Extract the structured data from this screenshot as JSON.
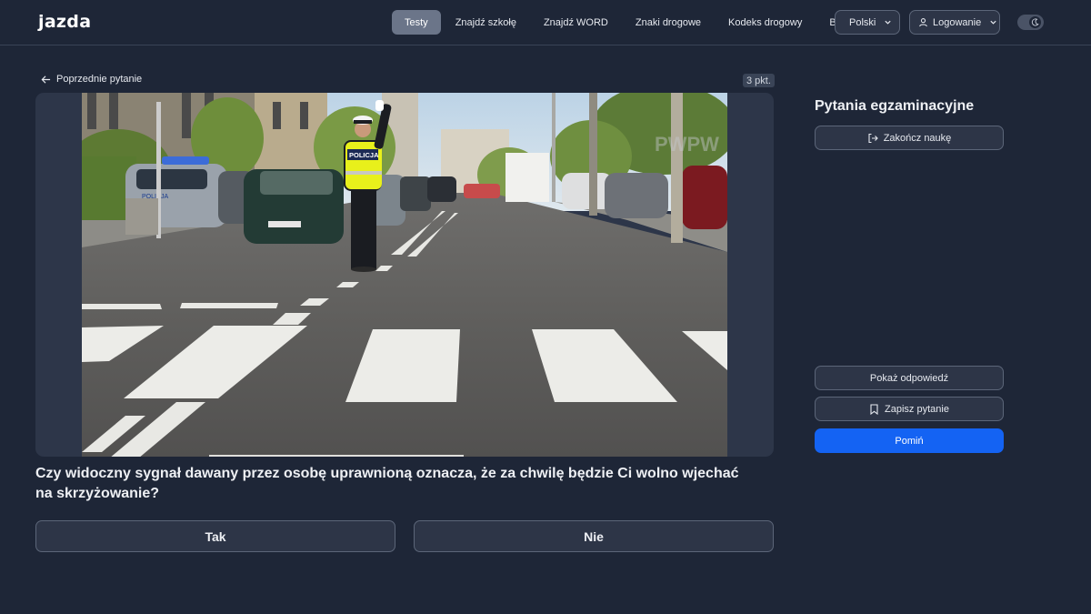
{
  "header": {
    "logo_text": "jazda",
    "nav": [
      {
        "label": "Testy",
        "active": true
      },
      {
        "label": "Znajdź szkołę",
        "active": false
      },
      {
        "label": "Znajdź WORD",
        "active": false
      },
      {
        "label": "Znaki drogowe",
        "active": false
      },
      {
        "label": "Kodeks drogowy",
        "active": false
      },
      {
        "label": "Blog",
        "active": false
      }
    ],
    "language_label": "Polski",
    "login_label": "Logowanie",
    "theme_toggle": "dark"
  },
  "question_panel": {
    "back_label": "Poprzednie pytanie",
    "points_label": "3 pkt.",
    "image_signs": {
      "police_vest": "POLICJA",
      "police_car": "POLICJA",
      "watermark": "PWPW"
    },
    "question_text": "Czy widoczny sygnał dawany przez osobę uprawnioną oznacza, że za chwilę będzie Ci wolno wjechać na skrzyżowanie?",
    "answers": [
      "Tak",
      "Nie"
    ]
  },
  "sidebar": {
    "title": "Pytania egzaminacyjne",
    "end_label": "Zakończ naukę",
    "show_answer_label": "Pokaż odpowiedź",
    "save_label": "Zapisz pytanie",
    "skip_label": "Pomiń"
  },
  "colors": {
    "background": "#1e2637",
    "accent": "#1463f3",
    "active_nav": "#6b7589"
  }
}
